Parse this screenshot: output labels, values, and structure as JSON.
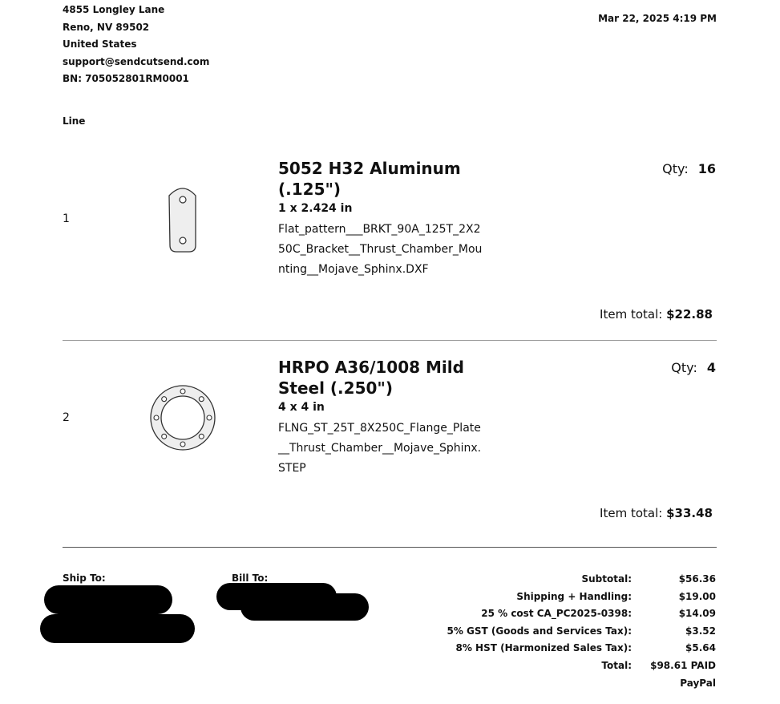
{
  "company": {
    "street": "4855 Longley Lane",
    "city": "Reno, NV 89502",
    "country": "United States",
    "email": "support@sendcutsend.com",
    "bn": "BN: 705052801RM0001"
  },
  "date": "Mar 22, 2025 4:19 PM",
  "line_header": "Line",
  "items": [
    {
      "line": "1",
      "title": "5052 H32 Aluminum (.125\")",
      "dims": "1 x 2.424 in",
      "file": "Flat_pattern___BRKT_90A_125T_2X250C_Bracket__Thrust_Chamber_Mounting__Mojave_Sphinx.DXF",
      "qty_label": "Qty:",
      "qty": "16",
      "total_label": "Item total:",
      "total": "$22.88",
      "thumbnail": "bracket-part-icon"
    },
    {
      "line": "2",
      "title": "HRPO A36/1008 Mild Steel (.250\")",
      "dims": "4 x 4 in",
      "file": "FLNG_ST_25T_8X250C_Flange_Plate__Thrust_Chamber__Mojave_Sphinx.STEP",
      "qty_label": "Qty:",
      "qty": "4",
      "total_label": "Item total:",
      "total": "$33.48",
      "thumbnail": "flange-part-icon"
    }
  ],
  "ship_to_label": "Ship To:",
  "bill_to_label": "Bill To:",
  "summary": [
    {
      "label": "Subtotal:",
      "value": "$56.36"
    },
    {
      "label": "Shipping + Handling:",
      "value": "$19.00"
    },
    {
      "label": "25 % cost CA_PC2025-0398:",
      "value": "$14.09"
    },
    {
      "label": "5% GST (Goods and Services Tax):",
      "value": "$3.52"
    },
    {
      "label": "8% HST (Harmonized Sales Tax):",
      "value": "$5.64"
    },
    {
      "label": "Total:",
      "value": "$98.61 PAID"
    },
    {
      "label": "",
      "value": "PayPal"
    }
  ]
}
